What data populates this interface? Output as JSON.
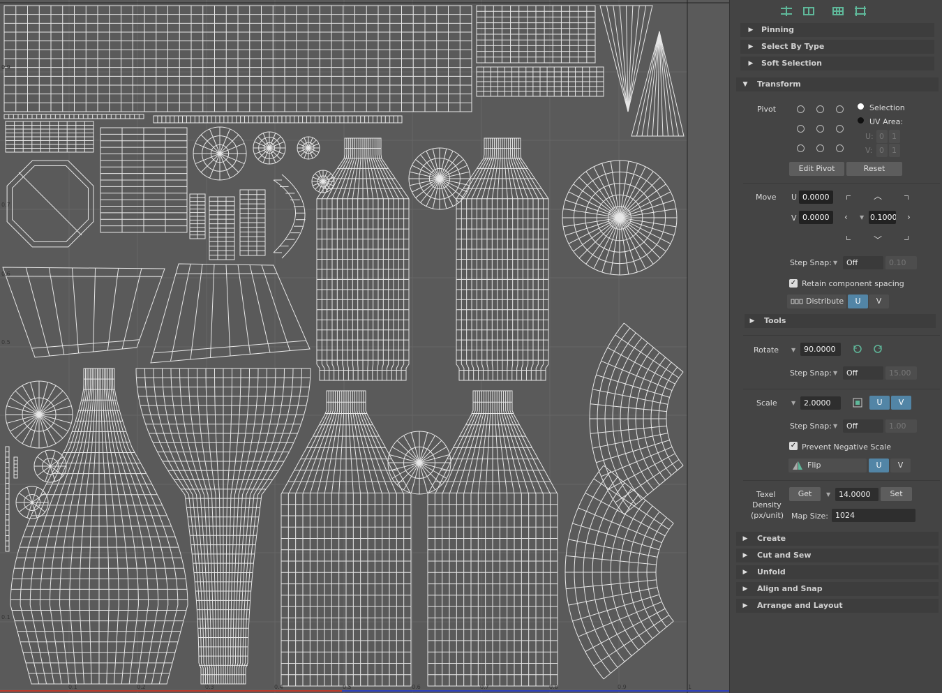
{
  "viewport": {
    "axis_ticks": [
      "0.1",
      "0.2",
      "0.3",
      "0.4",
      "0.5",
      "0.6",
      "0.7",
      "0.8",
      "0.9",
      "1"
    ],
    "side_ticks": [
      "0.9",
      "0.7",
      "0.6",
      "0.5",
      "0.1"
    ]
  },
  "toolbar": {
    "icons": [
      "unfold-icon",
      "layout-icon",
      "grid-icon",
      "distribute-icon"
    ]
  },
  "sections": {
    "pinning": "Pinning",
    "select_by_type": "Select By Type",
    "soft_selection": "Soft Selection",
    "transform": "Transform",
    "tools": "Tools",
    "create": "Create",
    "cut_and_sew": "Cut and Sew",
    "unfold": "Unfold",
    "align_and_snap": "Align and Snap",
    "arrange_and_layout": "Arrange and Layout"
  },
  "pivot": {
    "label": "Pivot",
    "selection": "Selection",
    "uv_area": "UV Area:",
    "u_label": "U:",
    "v_label": "V:",
    "u_values": [
      "0",
      "1"
    ],
    "v_values": [
      "0",
      "1"
    ],
    "edit_pivot": "Edit Pivot",
    "reset": "Reset"
  },
  "move": {
    "label": "Move",
    "u_label": "U",
    "v_label": "V",
    "u_value": "0.0000",
    "v_value": "0.0000",
    "step_value": "0.1000",
    "step_snap_label": "Step Snap:",
    "step_snap_mode": "Off",
    "step_snap_value": "0.10",
    "retain_label": "Retain component spacing",
    "distribute_label": "Distribute",
    "u_btn": "U",
    "v_btn": "V"
  },
  "rotate": {
    "label": "Rotate",
    "value": "90.0000",
    "step_snap_label": "Step Snap:",
    "step_snap_mode": "Off",
    "step_snap_value": "15.00"
  },
  "scale": {
    "label": "Scale",
    "value": "2.0000",
    "u_btn": "U",
    "v_btn": "V",
    "step_snap_label": "Step Snap:",
    "step_snap_mode": "Off",
    "step_snap_value": "1.00",
    "prevent_label": "Prevent Negative Scale",
    "flip_label": "Flip",
    "flip_u": "U",
    "flip_v": "V"
  },
  "texel": {
    "label_1": "Texel",
    "label_2": "Density",
    "label_3": "(px/unit)",
    "get": "Get",
    "value": "14.0000",
    "set": "Set",
    "map_size_label": "Map Size:",
    "map_size": "1024"
  },
  "colors": {
    "accent_blue": "#5285a6",
    "panel_bg": "#444444",
    "viewport_bg": "#5a5a5a"
  }
}
